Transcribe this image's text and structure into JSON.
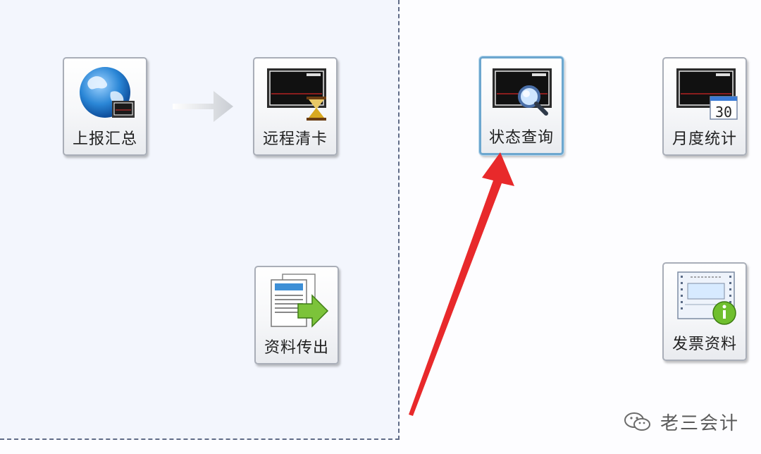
{
  "tiles": {
    "upload_summary": "上报汇总",
    "remote_clear": "远程清卡",
    "export_data": "资料传出",
    "status_query": "状态查询",
    "monthly_stats": "月度统计",
    "invoice_data": "发票资料"
  },
  "calendar_day": "30",
  "watermark": "老三会计",
  "colors": {
    "accent_arrow": "#e8292b",
    "active_border": "#6da7cf",
    "flow_arrow": "#c9cdd3"
  }
}
